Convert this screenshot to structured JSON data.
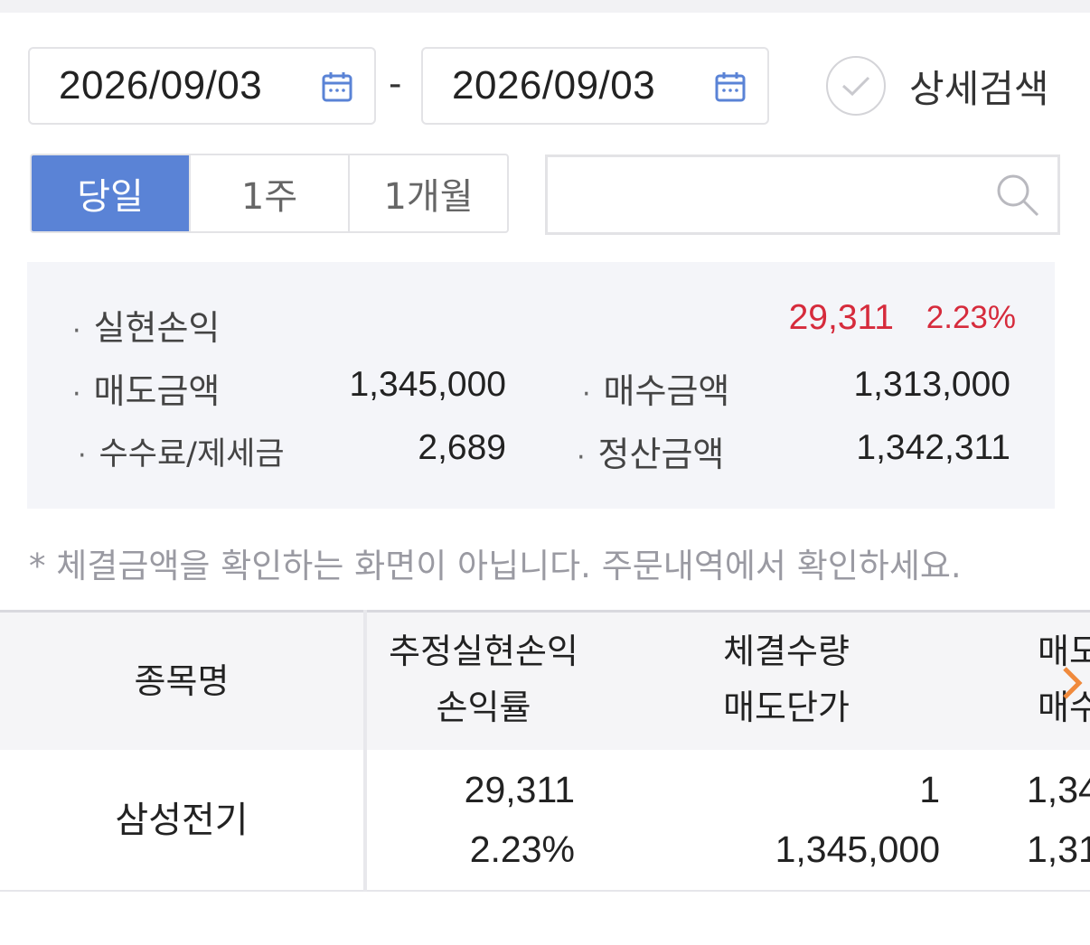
{
  "date_range": {
    "start": "2026/09/03",
    "separator": "-",
    "end": "2026/09/03"
  },
  "detail_search": {
    "label": "상세검색"
  },
  "period_tabs": [
    {
      "label": "당일",
      "active": true
    },
    {
      "label": "1주",
      "active": false
    },
    {
      "label": "1개월",
      "active": false
    }
  ],
  "search": {
    "placeholder": ""
  },
  "summary": {
    "dot": "·",
    "realized_pl": {
      "label": "실현손익",
      "value": "29,311",
      "rate": "2.23%"
    },
    "sell_amount": {
      "label": "매도금액",
      "value": "1,345,000"
    },
    "buy_amount": {
      "label": "매수금액",
      "value": "1,313,000"
    },
    "fee_tax": {
      "label": "수수료/제세금",
      "value": "2,689"
    },
    "settlement": {
      "label": "정산금액",
      "value": "1,342,311"
    }
  },
  "notice": "* 체결금액을 확인하는 화면이 아닙니다. 주문내역에서 확인하세요.",
  "table": {
    "headers": {
      "name": "종목명",
      "pl_top": "추정실현손익",
      "pl_bottom": "손익률",
      "qty_top": "체결수량",
      "qty_bottom": "매도단가",
      "amt_top": "매도",
      "amt_bottom": "매수"
    },
    "rows": [
      {
        "name": "삼성전기",
        "pl": "29,311",
        "rate": "2.23%",
        "qty": "1",
        "sell_price": "1,345,000",
        "col4_top": "1,34",
        "col4_bottom": "1,31"
      }
    ]
  },
  "colors": {
    "accent": "#5a83d6",
    "profit": "#d62b3c",
    "chevron": "#f08a3c"
  },
  "icons": {
    "calendar": "calendar-icon",
    "check": "check-circle-icon",
    "search": "search-icon",
    "chevron": "chevron-right-icon"
  }
}
